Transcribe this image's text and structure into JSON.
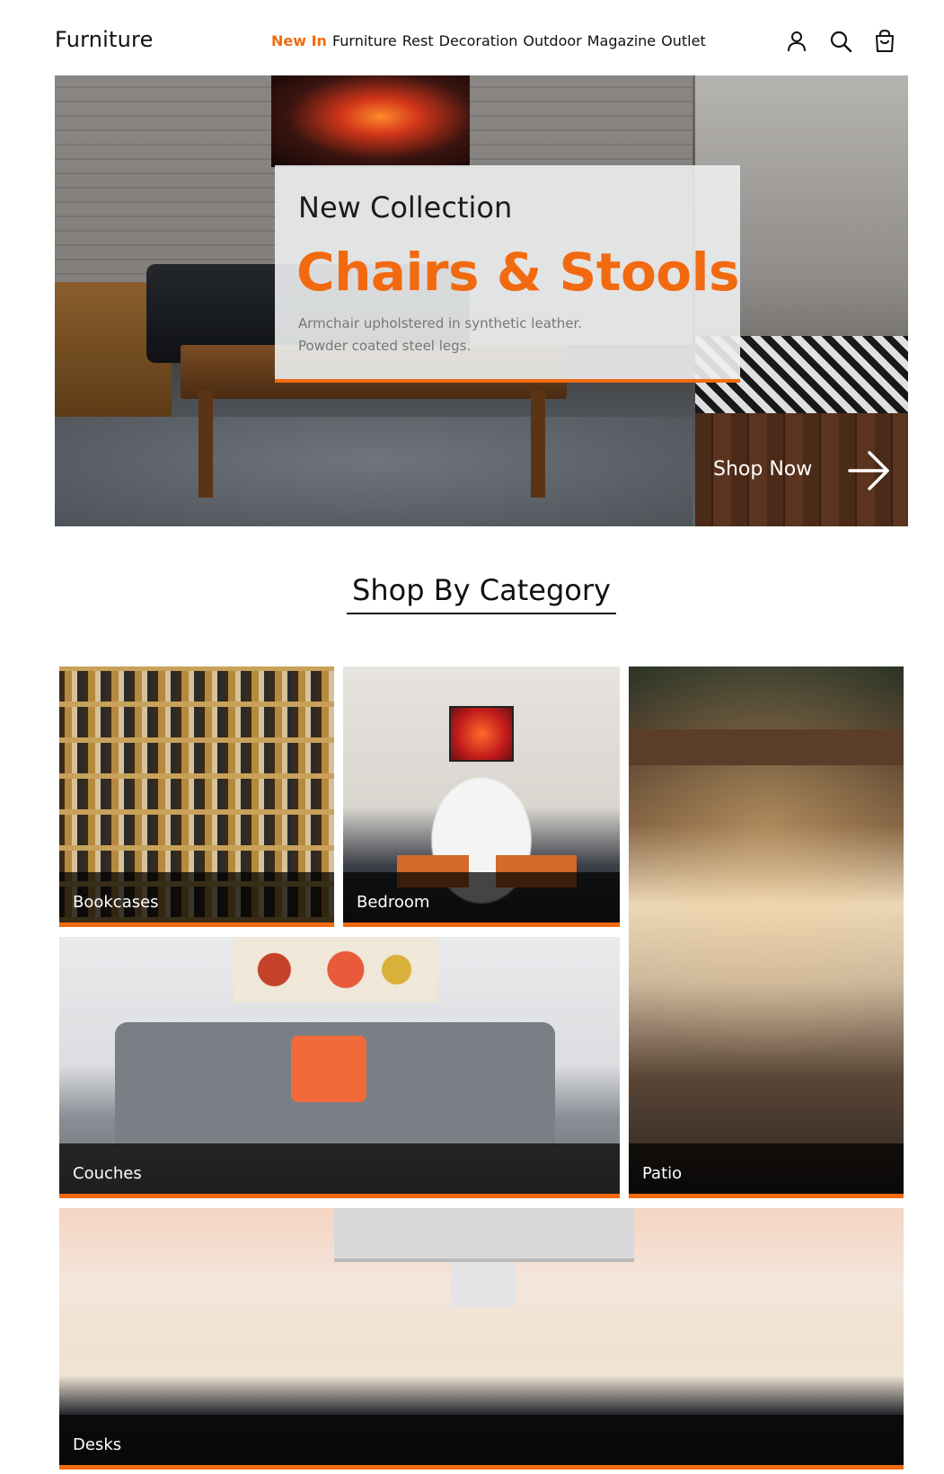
{
  "header": {
    "brand": "Furniture",
    "nav": [
      {
        "label": "New In",
        "active": true
      },
      {
        "label": "Furniture",
        "active": false
      },
      {
        "label": "Rest",
        "active": false
      },
      {
        "label": "Decoration",
        "active": false
      },
      {
        "label": "Outdoor",
        "active": false
      },
      {
        "label": "Magazine",
        "active": false
      },
      {
        "label": "Outlet",
        "active": false
      }
    ],
    "icons": [
      "user-icon",
      "search-icon",
      "cart-icon"
    ]
  },
  "hero": {
    "eyebrow": "New Collection",
    "title": "Chairs & Stools",
    "description_line1": "Armchair upholstered in synthetic leather.",
    "description_line2": "Powder coated steel legs.",
    "cta_label": "Shop Now",
    "cta_icon": "arrow-right-icon"
  },
  "categories_section": {
    "title": "Shop By Category",
    "items": [
      {
        "label": "Bookcases"
      },
      {
        "label": "Bedroom"
      },
      {
        "label": "Patio"
      },
      {
        "label": "Couches"
      },
      {
        "label": "Desks"
      }
    ]
  },
  "colors": {
    "accent": "#f26a10",
    "text": "#111111",
    "caption_overlay": "#000000"
  }
}
